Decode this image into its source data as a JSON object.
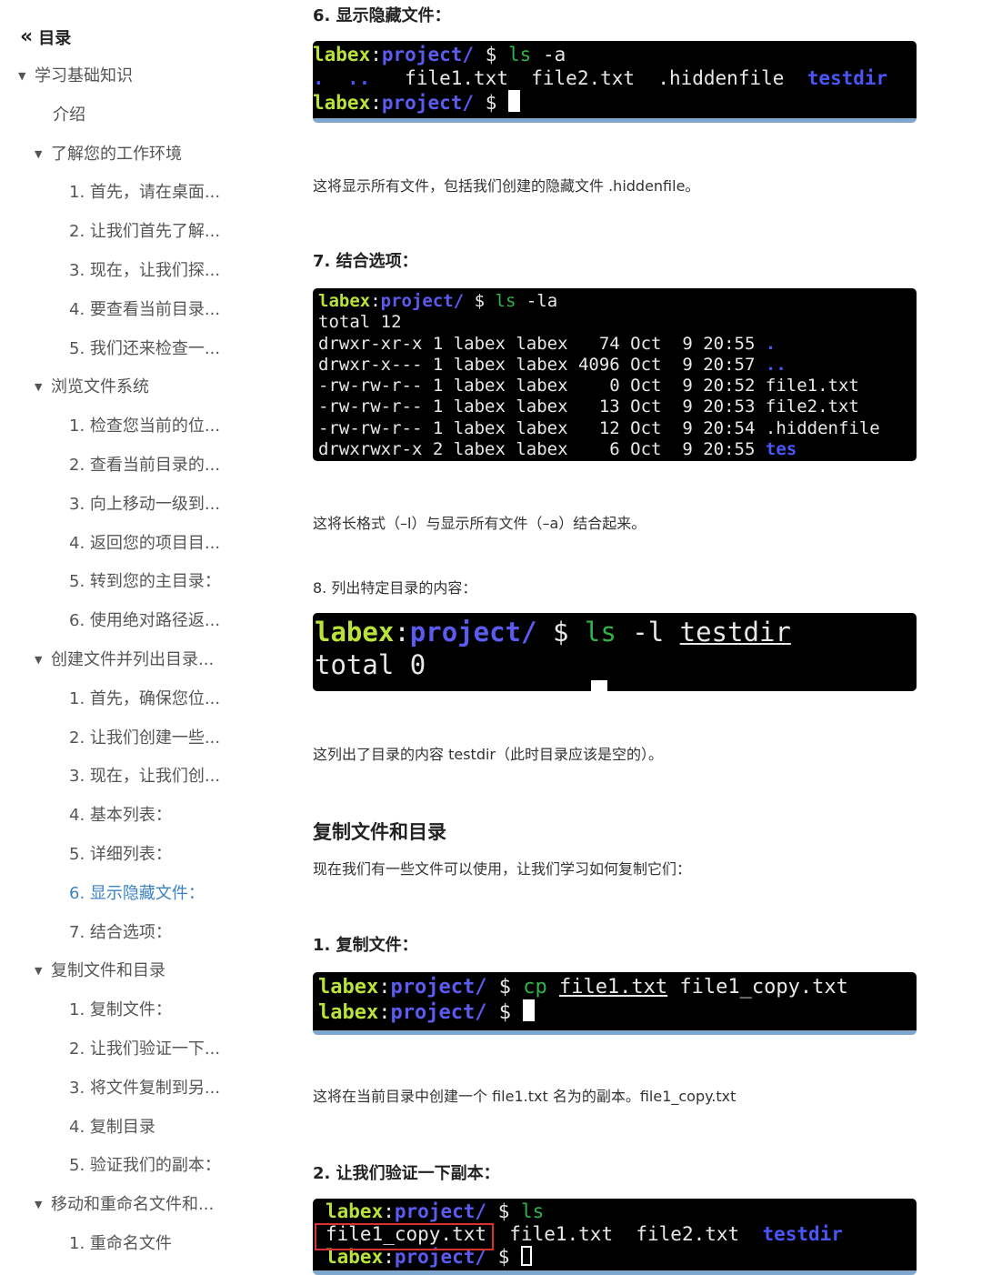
{
  "sidebar": {
    "title": "目录",
    "items": [
      {
        "label": "学习基础知识",
        "tri": "▼"
      },
      {
        "label": "介绍",
        "tri": ""
      },
      {
        "label": "了解您的工作环境",
        "tri": "▼"
      },
      {
        "label": "1. 首先，请在桌面...",
        "tri": ""
      },
      {
        "label": "2. 让我们首先了解...",
        "tri": ""
      },
      {
        "label": "3. 现在，让我们探...",
        "tri": ""
      },
      {
        "label": "4. 要查看当前目录...",
        "tri": ""
      },
      {
        "label": "5. 我们还来检查一...",
        "tri": ""
      },
      {
        "label": "浏览文件系统",
        "tri": "▼"
      },
      {
        "label": "1. 检查您当前的位...",
        "tri": ""
      },
      {
        "label": "2. 查看当前目录的...",
        "tri": ""
      },
      {
        "label": "3. 向上移动一级到...",
        "tri": ""
      },
      {
        "label": "4. 返回您的项目目...",
        "tri": ""
      },
      {
        "label": "5. 转到您的主目录：",
        "tri": ""
      },
      {
        "label": "6. 使用绝对路径返...",
        "tri": ""
      },
      {
        "label": "创建文件并列出目录...",
        "tri": "▼"
      },
      {
        "label": "1. 首先，确保您位...",
        "tri": ""
      },
      {
        "label": "2. 让我们创建一些...",
        "tri": ""
      },
      {
        "label": "3. 现在，让我们创...",
        "tri": ""
      },
      {
        "label": "4. 基本列表：",
        "tri": ""
      },
      {
        "label": "5. 详细列表：",
        "tri": ""
      },
      {
        "label": "6. 显示隐藏文件：",
        "tri": "",
        "active": true
      },
      {
        "label": "7. 结合选项：",
        "tri": ""
      },
      {
        "label": "复制文件和目录",
        "tri": "▼"
      },
      {
        "label": "1. 复制文件：",
        "tri": ""
      },
      {
        "label": "2. 让我们验证一下...",
        "tri": ""
      },
      {
        "label": "3. 将文件复制到另...",
        "tri": ""
      },
      {
        "label": "4. 复制目录",
        "tri": ""
      },
      {
        "label": "5. 验证我们的副本：",
        "tri": ""
      },
      {
        "label": "移动和重命名文件和...",
        "tri": "▼"
      },
      {
        "label": "1. 重命名文件",
        "tri": ""
      }
    ]
  },
  "main": {
    "step6_title": "6. 显示隐藏文件：",
    "step6_para": "这将显示所有文件，包括我们创建的隐藏文件 .hiddenfile。",
    "step7_title": "7. 结合选项：",
    "step7_para": "这将长格式（–l）与显示所有文件（–a）结合起来。",
    "step8_title": "8. 列出特定目录的内容：",
    "step8_para": "这列出了目录的内容 testdir（此时目录应该是空的）。",
    "section_title": "复制文件和目录",
    "section_intro": "现在我们有一些文件可以使用，让我们学习如何复制它们：",
    "copy1_title": "1. 复制文件：",
    "copy1_para": "这将在当前目录中创建一个 file1.txt 名为的副本。file1_copy.txt",
    "copy2_title": "2. 让我们验证一下副本："
  },
  "terminal": {
    "user": "labex",
    "path": "project/",
    "prompt": "$",
    "t1": {
      "cmd": "ls",
      "args": " -a",
      "dot1": ".",
      "dot2": "..",
      "files": "   file1.txt  file2.txt  .hiddenfile  ",
      "dir": "testdir"
    },
    "t2": {
      "cmd": "ls",
      "args": " -la",
      "total": "total 12",
      "rows": [
        {
          "text": "drwxr-xr-x 1 labex labex   74 Oct  9 20:55 ",
          "dir": "."
        },
        {
          "text": "drwxr-x--- 1 labex labex 4096 Oct  9 20:57 ",
          "dir": ".."
        },
        {
          "text": "-rw-rw-r-- 1 labex labex    0 Oct  9 20:52 file1.txt",
          "dir": ""
        },
        {
          "text": "-rw-rw-r-- 1 labex labex   13 Oct  9 20:53 file2.txt",
          "dir": ""
        },
        {
          "text": "-rw-rw-r-- 1 labex labex   12 Oct  9 20:54 .hiddenfile",
          "dir": ""
        },
        {
          "text": "drwxrwxr-x 2 labex labex    6 Oct  9 20:55 ",
          "dir": "tes"
        }
      ]
    },
    "t3": {
      "cmd": "ls",
      "args": " -l ",
      "target": "testdir",
      "total": "total 0"
    },
    "t4": {
      "cmd": "cp",
      "src": "file1.txt",
      "dst": " file1_copy.txt"
    },
    "t5": {
      "cmd": "ls",
      "copy": "file1_copy.txt",
      "files": "  file1.txt  file2.txt  ",
      "dir": "testdir"
    }
  }
}
